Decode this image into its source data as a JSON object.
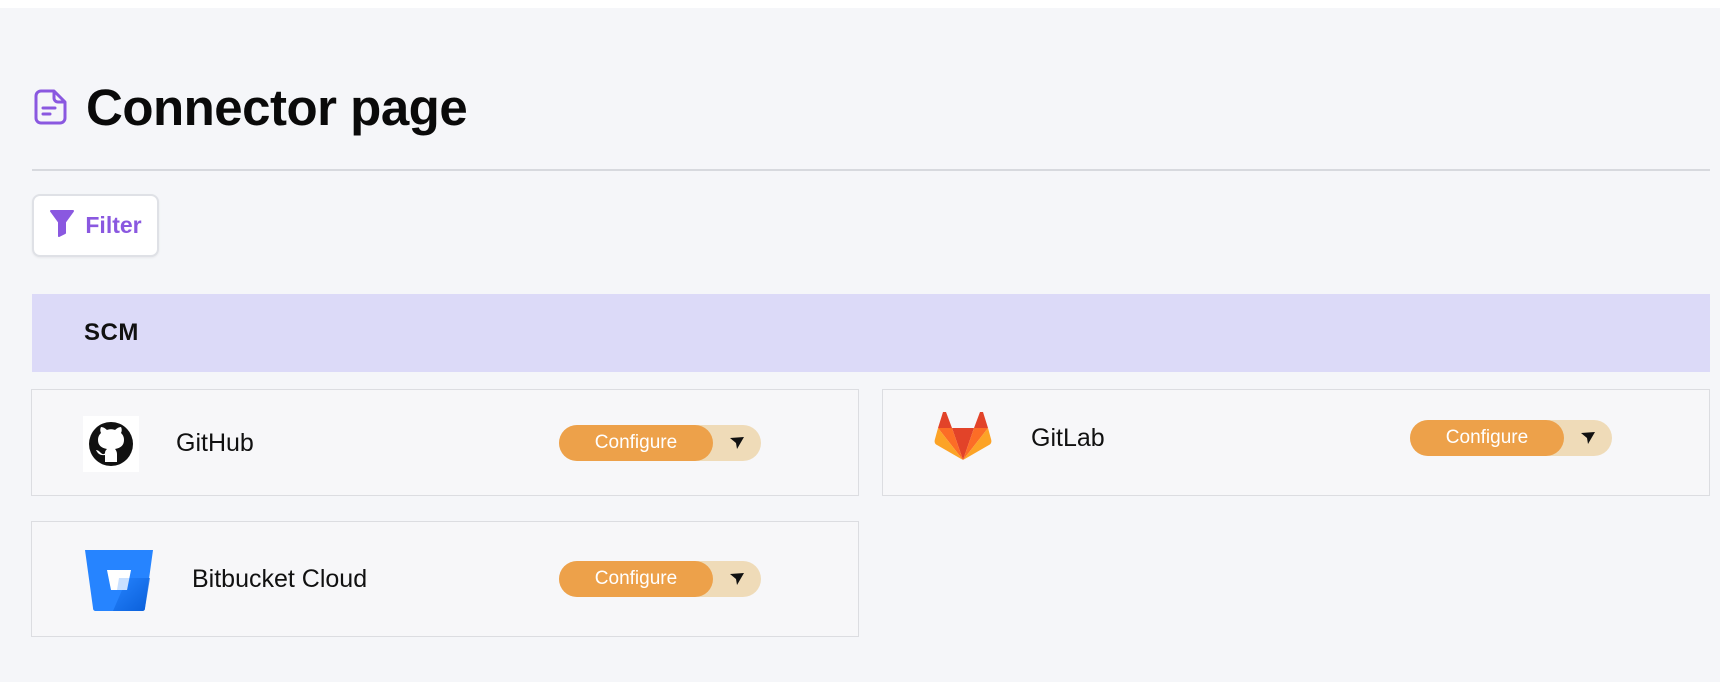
{
  "page": {
    "title": "Connector page",
    "icon": "document-icon"
  },
  "filter": {
    "label": "Filter",
    "icon": "funnel-icon"
  },
  "section": {
    "label": "SCM"
  },
  "connectors": [
    {
      "name": "GitHub",
      "icon": "github-icon",
      "action_label": "Configure"
    },
    {
      "name": "GitLab",
      "icon": "gitlab-icon",
      "action_label": "Configure"
    },
    {
      "name": "Bitbucket Cloud",
      "icon": "bitbucket-icon",
      "action_label": "Configure"
    }
  ],
  "colors": {
    "accent": "#8a58e0",
    "section_bg": "#dcdaf8",
    "button_primary": "#eda14a",
    "button_secondary": "#efdbb8"
  }
}
